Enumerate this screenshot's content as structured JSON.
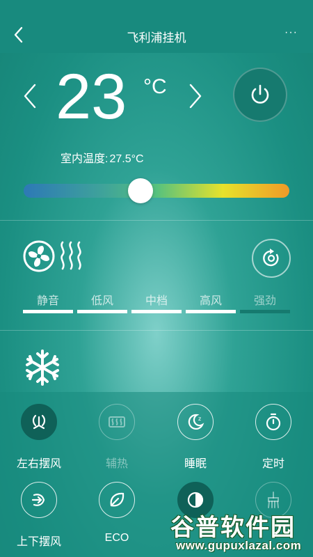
{
  "header": {
    "title": "飞利浦挂机",
    "more": "···"
  },
  "temperature": {
    "value": "23",
    "unit": "°C"
  },
  "indoor": {
    "label": "室内温度:",
    "value": "27.5°C"
  },
  "slider": {
    "level": 0.44
  },
  "fan_speeds": [
    {
      "label": "静音",
      "selected": true
    },
    {
      "label": "低风",
      "selected": true
    },
    {
      "label": "中档",
      "selected": true
    },
    {
      "label": "高风",
      "selected": true
    },
    {
      "label": "强劲",
      "selected": false
    }
  ],
  "functions": [
    {
      "label": "左右摆风",
      "icon": "swing-horizontal-icon",
      "state": "active"
    },
    {
      "label": "辅热",
      "icon": "aux-heat-icon",
      "state": "disabled"
    },
    {
      "label": "睡眠",
      "icon": "sleep-icon",
      "state": "normal"
    },
    {
      "label": "定时",
      "icon": "timer-icon",
      "state": "normal"
    },
    {
      "label": "上下摆风",
      "icon": "swing-vertical-icon",
      "state": "normal"
    },
    {
      "label": "ECO",
      "icon": "eco-leaf-icon",
      "state": "normal"
    },
    {
      "label": "",
      "icon": "contrast-icon",
      "state": "active"
    },
    {
      "label": "",
      "icon": "clean-icon",
      "state": "disabled"
    }
  ],
  "watermark": {
    "text": "谷普软件园",
    "url": "www.gupuxlazal.com"
  },
  "colors": {
    "header": "#188a7e",
    "accent": "#0f6158",
    "slider_thumb": "#ffffff"
  }
}
